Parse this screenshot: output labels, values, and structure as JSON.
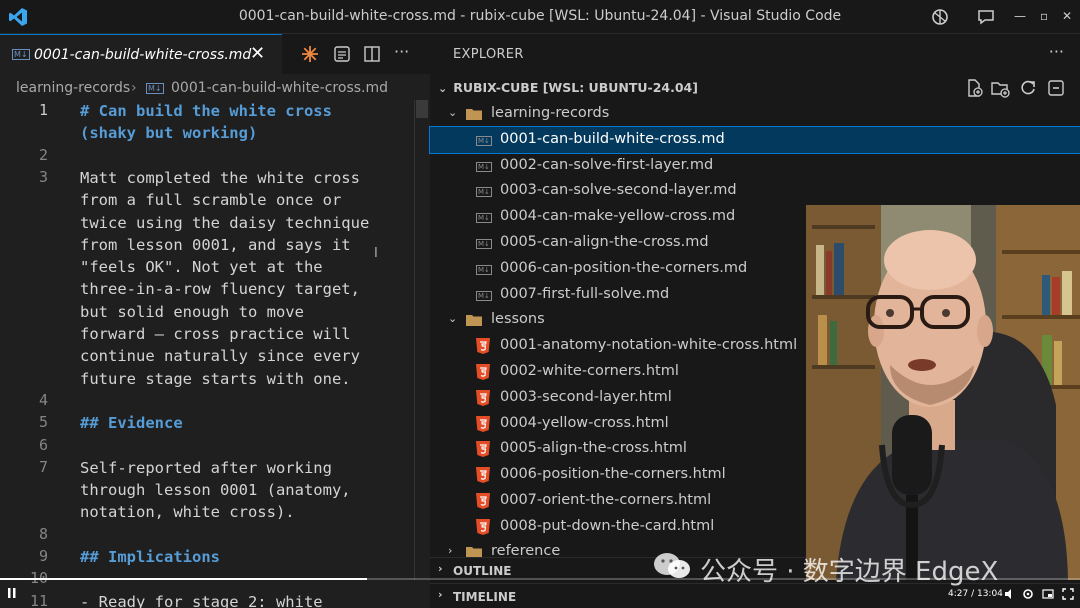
{
  "window": {
    "title": "0001-can-build-white-cross.md - rubix-cube [WSL: Ubuntu-24.04] - Visual Studio Code"
  },
  "editor": {
    "tab_label": "0001-can-build-white-cross.md",
    "tab_badge": "M↓",
    "breadcrumb": [
      "learning-records",
      "0001-can-build-white-cross.md"
    ],
    "lines": [
      {
        "n": "1",
        "rows": [
          "# Can build the white cross",
          "(shaky but working)"
        ],
        "kind": "heading"
      },
      {
        "n": "2",
        "rows": [
          ""
        ],
        "kind": "text"
      },
      {
        "n": "3",
        "rows": [
          "Matt completed the white cross",
          "from a full scramble once or",
          "twice using the daisy technique",
          "from lesson 0001, and says it",
          "\"feels OK\". Not yet at the",
          "three-in-a-row fluency target,",
          "but solid enough to move",
          "forward — cross practice will",
          "continue naturally since every",
          "future stage starts with one."
        ],
        "kind": "text"
      },
      {
        "n": "4",
        "rows": [
          ""
        ],
        "kind": "text"
      },
      {
        "n": "5",
        "rows": [
          "## Evidence"
        ],
        "kind": "heading"
      },
      {
        "n": "6",
        "rows": [
          ""
        ],
        "kind": "text"
      },
      {
        "n": "7",
        "rows": [
          "Self-reported after working",
          "through lesson 0001 (anatomy,",
          "notation, white cross)."
        ],
        "kind": "text"
      },
      {
        "n": "8",
        "rows": [
          ""
        ],
        "kind": "text"
      },
      {
        "n": "9",
        "rows": [
          "## Implications"
        ],
        "kind": "heading"
      },
      {
        "n": "10",
        "rows": [
          ""
        ],
        "kind": "text"
      },
      {
        "n": "11",
        "rows": [
          "- Ready for stage 2: white"
        ],
        "kind": "text"
      }
    ]
  },
  "explorer": {
    "header": "EXPLORER",
    "root": "RUBIX-CUBE [WSL: UBUNTU-24.04]",
    "folders": [
      {
        "name": "learning-records",
        "files": [
          "0001-can-build-white-cross.md",
          "0002-can-solve-first-layer.md",
          "0003-can-solve-second-layer.md",
          "0004-can-make-yellow-cross.md",
          "0005-can-align-the-cross.md",
          "0006-can-position-the-corners.md",
          "0007-first-full-solve.md"
        ]
      },
      {
        "name": "lessons",
        "files": [
          "0001-anatomy-notation-white-cross.html",
          "0002-white-corners.html",
          "0003-second-layer.html",
          "0004-yellow-cross.html",
          "0005-align-the-cross.html",
          "0006-position-the-corners.html",
          "0007-orient-the-corners.html",
          "0008-put-down-the-card.html"
        ]
      }
    ],
    "collapsed_folder": "reference",
    "selected_file": "0001-can-build-white-cross.md",
    "sections": [
      "OUTLINE",
      "TIMELINE"
    ]
  },
  "watermark": "公众号 · 数字边界 EdgeX",
  "player": {
    "time": "4:27 / 13:04",
    "progress": 0.34
  },
  "colors": {
    "accent": "#0078d4",
    "heading": "#569cd6",
    "html_icon": "#e44d26",
    "folder": "#c09553"
  }
}
